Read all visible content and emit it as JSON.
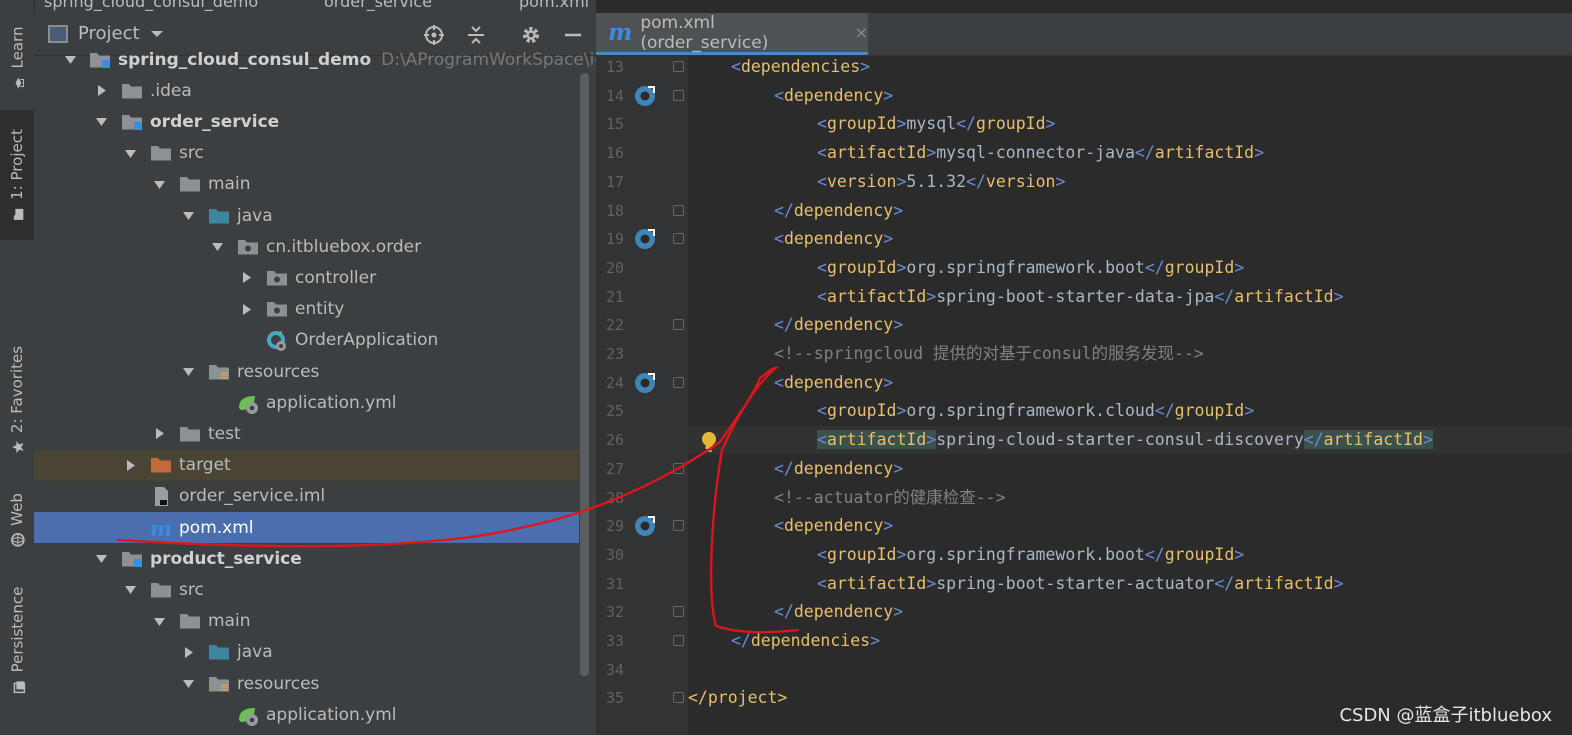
{
  "breadcrumb": {
    "items": [
      "spring_cloud_consul_demo",
      "order_service",
      "pom.xml"
    ]
  },
  "toolstrip": {
    "tabs": [
      {
        "label": "Learn",
        "icon": "learn-icon"
      },
      {
        "label": "1: Project",
        "icon": "folder-icon"
      },
      {
        "label": "2: Favorites",
        "icon": "star-icon"
      },
      {
        "label": "Web",
        "icon": "globe-icon"
      },
      {
        "label": "Persistence",
        "icon": "persistence-icon"
      }
    ]
  },
  "project_panel": {
    "title": "Project",
    "tree": [
      {
        "label": "spring_cloud_consul_demo",
        "path": "D:\\AProgramWorkSpace\\idea\\te",
        "icon": "module-folder-icon",
        "depth": 0,
        "arrow": "down",
        "bold": true
      },
      {
        "label": ".idea",
        "icon": "folder-icon",
        "depth": 1,
        "arrow": "right"
      },
      {
        "label": "order_service",
        "icon": "module-folder-icon",
        "depth": 1,
        "arrow": "down",
        "bold": true
      },
      {
        "label": "src",
        "icon": "folder-icon",
        "depth": 2,
        "arrow": "down"
      },
      {
        "label": "main",
        "icon": "folder-icon",
        "depth": 3,
        "arrow": "down"
      },
      {
        "label": "java",
        "icon": "source-folder-icon",
        "depth": 4,
        "arrow": "down"
      },
      {
        "label": "cn.itbluebox.order",
        "icon": "package-icon",
        "depth": 5,
        "arrow": "down"
      },
      {
        "label": "controller",
        "icon": "package-icon",
        "depth": 6,
        "arrow": "right"
      },
      {
        "label": "entity",
        "icon": "package-icon",
        "depth": 6,
        "arrow": "right"
      },
      {
        "label": "OrderApplication",
        "icon": "spring-class-icon",
        "depth": 6,
        "arrow": "none"
      },
      {
        "label": "resources",
        "icon": "resources-folder-icon",
        "depth": 4,
        "arrow": "down"
      },
      {
        "label": "application.yml",
        "icon": "spring-yml-icon",
        "depth": 5,
        "arrow": "none"
      },
      {
        "label": "test",
        "icon": "folder-icon",
        "depth": 3,
        "arrow": "right"
      },
      {
        "label": "target",
        "icon": "excluded-folder-icon",
        "depth": 2,
        "arrow": "right",
        "state": "excluded"
      },
      {
        "label": "order_service.iml",
        "icon": "iml-file-icon",
        "depth": 2,
        "arrow": "none"
      },
      {
        "label": "pom.xml",
        "icon": "maven-icon",
        "depth": 2,
        "arrow": "none",
        "state": "selected"
      },
      {
        "label": "product_service",
        "icon": "module-folder-icon",
        "depth": 1,
        "arrow": "down",
        "bold": true
      },
      {
        "label": "src",
        "icon": "folder-icon",
        "depth": 2,
        "arrow": "down"
      },
      {
        "label": "main",
        "icon": "folder-icon",
        "depth": 3,
        "arrow": "down"
      },
      {
        "label": "java",
        "icon": "source-folder-icon",
        "depth": 4,
        "arrow": "right"
      },
      {
        "label": "resources",
        "icon": "resources-folder-icon",
        "depth": 4,
        "arrow": "down"
      },
      {
        "label": "application.yml",
        "icon": "spring-yml-icon",
        "depth": 5,
        "arrow": "none"
      }
    ]
  },
  "editor": {
    "tab": {
      "label": "pom.xml (order_service)",
      "logo": "m",
      "close": "×"
    },
    "current_line": 26,
    "lines": [
      {
        "n": "13",
        "indent": 1,
        "tokens": [
          [
            "b",
            "<"
          ],
          [
            "t",
            "dependencies"
          ],
          [
            "b",
            ">"
          ]
        ],
        "fold": true
      },
      {
        "n": "14",
        "indent": 2,
        "tokens": [
          [
            "b",
            "<"
          ],
          [
            "t",
            "dependency"
          ],
          [
            "b",
            ">"
          ]
        ],
        "fold": true,
        "gicon": true
      },
      {
        "n": "15",
        "indent": 3,
        "tokens": [
          [
            "b",
            "<"
          ],
          [
            "t",
            "groupId"
          ],
          [
            "b",
            ">"
          ],
          [
            "v",
            "mysql"
          ],
          [
            "b",
            "</"
          ],
          [
            "t",
            "groupId"
          ],
          [
            "b",
            ">"
          ]
        ]
      },
      {
        "n": "16",
        "indent": 3,
        "tokens": [
          [
            "b",
            "<"
          ],
          [
            "t",
            "artifactId"
          ],
          [
            "b",
            ">"
          ],
          [
            "v",
            "mysql-connector-java"
          ],
          [
            "b",
            "</"
          ],
          [
            "t",
            "artifactId"
          ],
          [
            "b",
            ">"
          ]
        ]
      },
      {
        "n": "17",
        "indent": 3,
        "tokens": [
          [
            "b",
            "<"
          ],
          [
            "t",
            "version"
          ],
          [
            "b",
            ">"
          ],
          [
            "v",
            "5.1.32"
          ],
          [
            "b",
            "</"
          ],
          [
            "t",
            "version"
          ],
          [
            "b",
            ">"
          ]
        ]
      },
      {
        "n": "18",
        "indent": 2,
        "tokens": [
          [
            "b",
            "</"
          ],
          [
            "t",
            "dependency"
          ],
          [
            "b",
            ">"
          ]
        ],
        "fold": true
      },
      {
        "n": "19",
        "indent": 2,
        "tokens": [
          [
            "b",
            "<"
          ],
          [
            "t",
            "dependency"
          ],
          [
            "b",
            ">"
          ]
        ],
        "fold": true,
        "gicon": true
      },
      {
        "n": "20",
        "indent": 3,
        "tokens": [
          [
            "b",
            "<"
          ],
          [
            "t",
            "groupId"
          ],
          [
            "b",
            ">"
          ],
          [
            "v",
            "org.springframework.boot"
          ],
          [
            "b",
            "</"
          ],
          [
            "t",
            "groupId"
          ],
          [
            "b",
            ">"
          ]
        ]
      },
      {
        "n": "21",
        "indent": 3,
        "tokens": [
          [
            "b",
            "<"
          ],
          [
            "t",
            "artifactId"
          ],
          [
            "b",
            ">"
          ],
          [
            "v",
            "spring-boot-starter-data-jpa"
          ],
          [
            "b",
            "</"
          ],
          [
            "t",
            "artifactId"
          ],
          [
            "b",
            ">"
          ]
        ]
      },
      {
        "n": "22",
        "indent": 2,
        "tokens": [
          [
            "b",
            "</"
          ],
          [
            "t",
            "dependency"
          ],
          [
            "b",
            ">"
          ]
        ],
        "fold": true
      },
      {
        "n": "23",
        "indent": 2,
        "tokens": [
          [
            "c",
            "<!--springcloud 提供的对基于consul的服务发现-->"
          ]
        ]
      },
      {
        "n": "24",
        "indent": 2,
        "tokens": [
          [
            "b",
            "<"
          ],
          [
            "t",
            "dependency"
          ],
          [
            "b",
            ">"
          ]
        ],
        "fold": true,
        "gicon": true
      },
      {
        "n": "25",
        "indent": 3,
        "tokens": [
          [
            "b",
            "<"
          ],
          [
            "t",
            "groupId"
          ],
          [
            "b",
            ">"
          ],
          [
            "v",
            "org.springframework.cloud"
          ],
          [
            "b",
            "</"
          ],
          [
            "t",
            "groupId"
          ],
          [
            "b",
            ">"
          ]
        ]
      },
      {
        "n": "26",
        "indent": 3,
        "tokens": [
          [
            "b",
            "<"
          ],
          [
            "t",
            "artifactId"
          ],
          [
            "b",
            ">"
          ],
          [
            "v",
            "spring-cloud-starter-consul-discovery"
          ],
          [
            "b",
            "</"
          ],
          [
            "t",
            "artifactId"
          ],
          [
            "b",
            ">"
          ]
        ],
        "bulb": true
      },
      {
        "n": "27",
        "indent": 2,
        "tokens": [
          [
            "b",
            "</"
          ],
          [
            "t",
            "dependency"
          ],
          [
            "b",
            ">"
          ]
        ],
        "fold": true
      },
      {
        "n": "28",
        "indent": 2,
        "tokens": [
          [
            "c",
            "<!--actuator的健康检查-->"
          ]
        ]
      },
      {
        "n": "29",
        "indent": 2,
        "tokens": [
          [
            "b",
            "<"
          ],
          [
            "t",
            "dependency"
          ],
          [
            "b",
            ">"
          ]
        ],
        "fold": true,
        "gicon": true
      },
      {
        "n": "30",
        "indent": 3,
        "tokens": [
          [
            "b",
            "<"
          ],
          [
            "t",
            "groupId"
          ],
          [
            "b",
            ">"
          ],
          [
            "v",
            "org.springframework.boot"
          ],
          [
            "b",
            "</"
          ],
          [
            "t",
            "groupId"
          ],
          [
            "b",
            ">"
          ]
        ]
      },
      {
        "n": "31",
        "indent": 3,
        "tokens": [
          [
            "b",
            "<"
          ],
          [
            "t",
            "artifactId"
          ],
          [
            "b",
            ">"
          ],
          [
            "v",
            "spring-boot-starter-actuator"
          ],
          [
            "b",
            "</"
          ],
          [
            "t",
            "artifactId"
          ],
          [
            "b",
            ">"
          ]
        ]
      },
      {
        "n": "32",
        "indent": 2,
        "tokens": [
          [
            "b",
            "</"
          ],
          [
            "t",
            "dependency"
          ],
          [
            "b",
            ">"
          ]
        ],
        "fold": true
      },
      {
        "n": "33",
        "indent": 1,
        "tokens": [
          [
            "b",
            "</"
          ],
          [
            "t",
            "dependencies"
          ],
          [
            "b",
            ">"
          ]
        ],
        "fold": true
      },
      {
        "n": "34",
        "indent": 0,
        "tokens": []
      },
      {
        "n": "35",
        "indent": 0,
        "tokens": [
          [
            "t",
            "</project>"
          ]
        ],
        "fold": true
      }
    ]
  },
  "watermark": "CSDN @蓝盒子itbluebox",
  "colors": {
    "annotation": "#e0151b",
    "selection": "#4b6eaf",
    "tag": "#e8bf6a",
    "bracket": "#6a8dd6"
  }
}
